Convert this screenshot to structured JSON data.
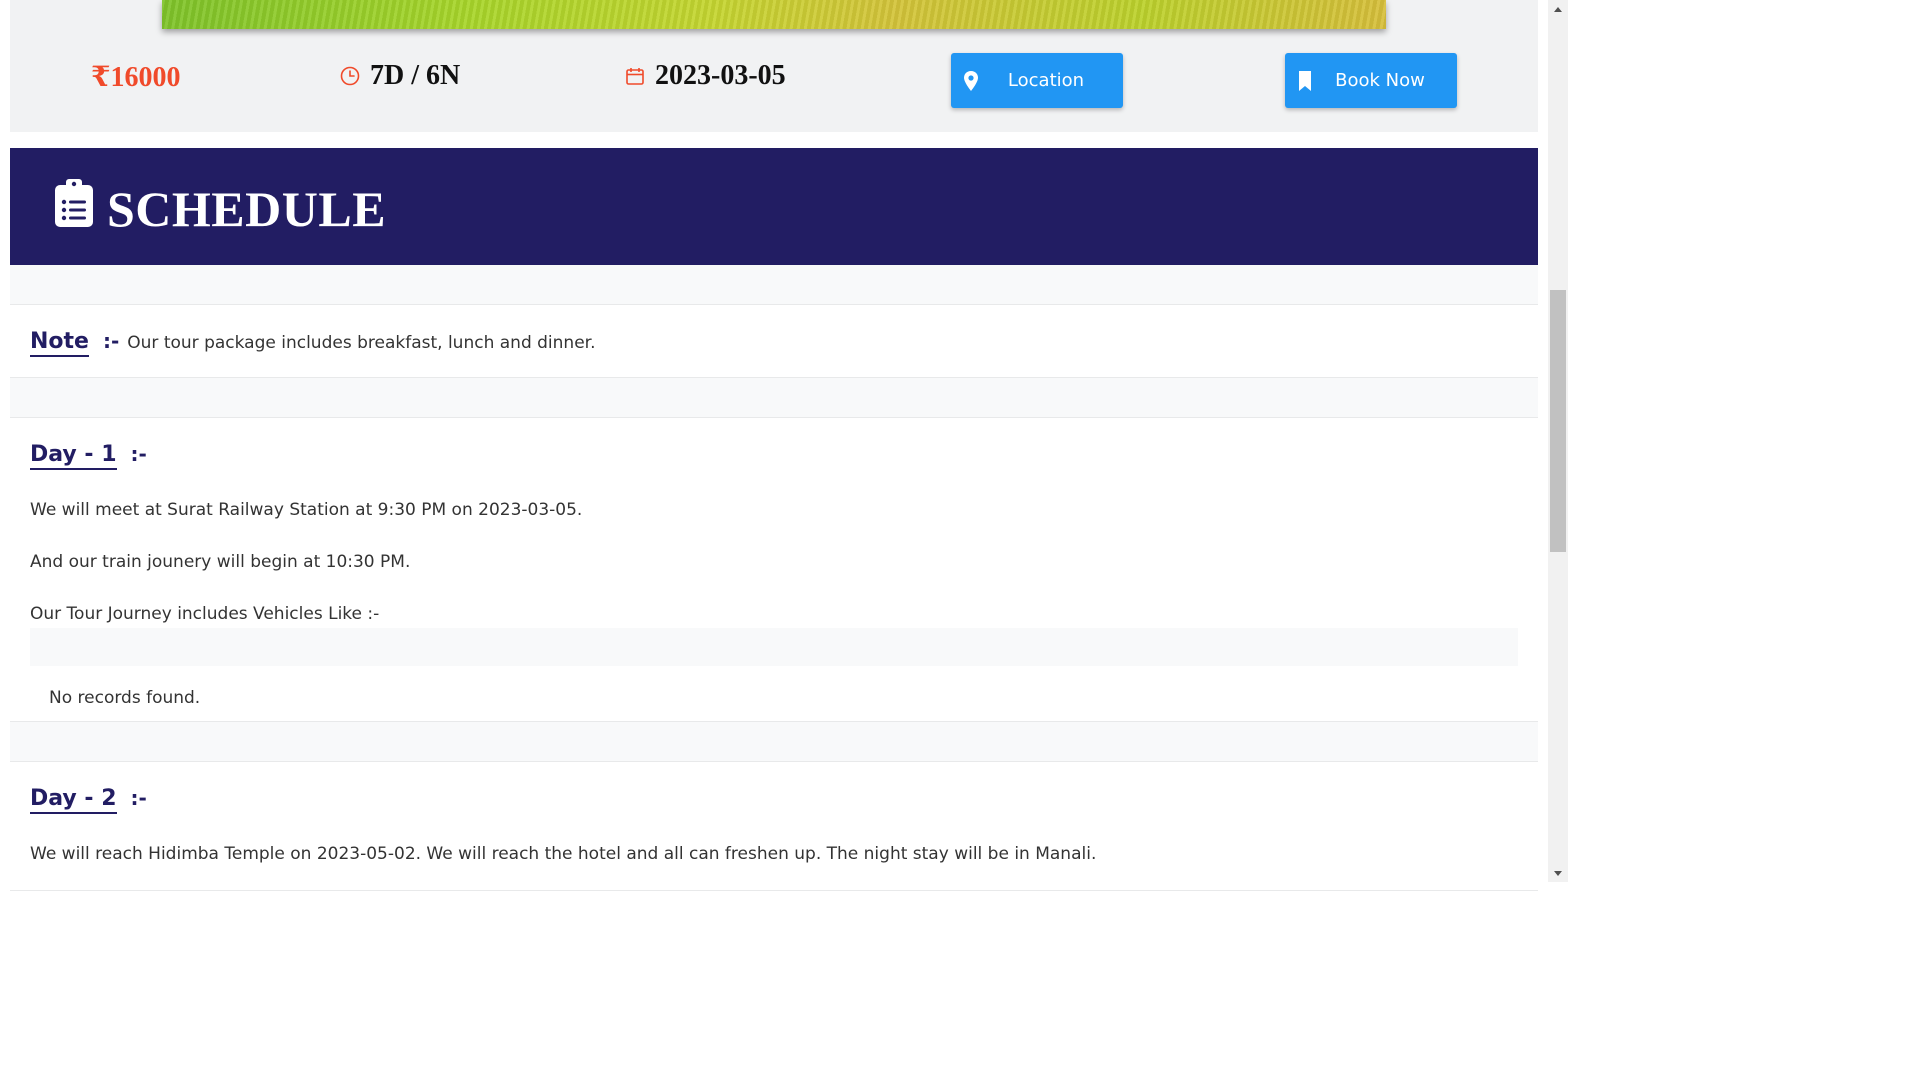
{
  "package": {
    "price": "₹16000",
    "duration": "7D / 6N",
    "date": "2023-03-05",
    "location_label": "Location",
    "book_label": "Book Now"
  },
  "schedule": {
    "title": "SCHEDULE",
    "note": {
      "heading": "Note",
      "separator": ":-",
      "text": "Our tour package includes breakfast, lunch and dinner."
    },
    "days": [
      {
        "heading": "Day - 1",
        "separator": ":-",
        "lines": [
          "We will meet at Surat Railway Station at 9:30 PM on 2023-03-05.",
          "And our train jounery will begin at 10:30 PM.",
          "Our Tour Journey includes Vehicles Like :-"
        ],
        "vehicles_empty": "No records found."
      },
      {
        "heading": "Day - 2",
        "separator": ":-",
        "lines": [
          "We will reach Hidimba Temple on 2023-05-02. We will reach the hotel and all can freshen up. The night stay will be in Manali."
        ]
      }
    ]
  },
  "colors": {
    "price": "#f04a2a",
    "primary_button": "#2196f3",
    "schedule_header": "#221d63",
    "icon_orange": "#f04a2a"
  },
  "icons": {
    "duration": "clock-icon",
    "date": "calendar-icon",
    "location": "map-pin-icon",
    "book": "bookmark-icon",
    "schedule": "clipboard-list-icon"
  }
}
